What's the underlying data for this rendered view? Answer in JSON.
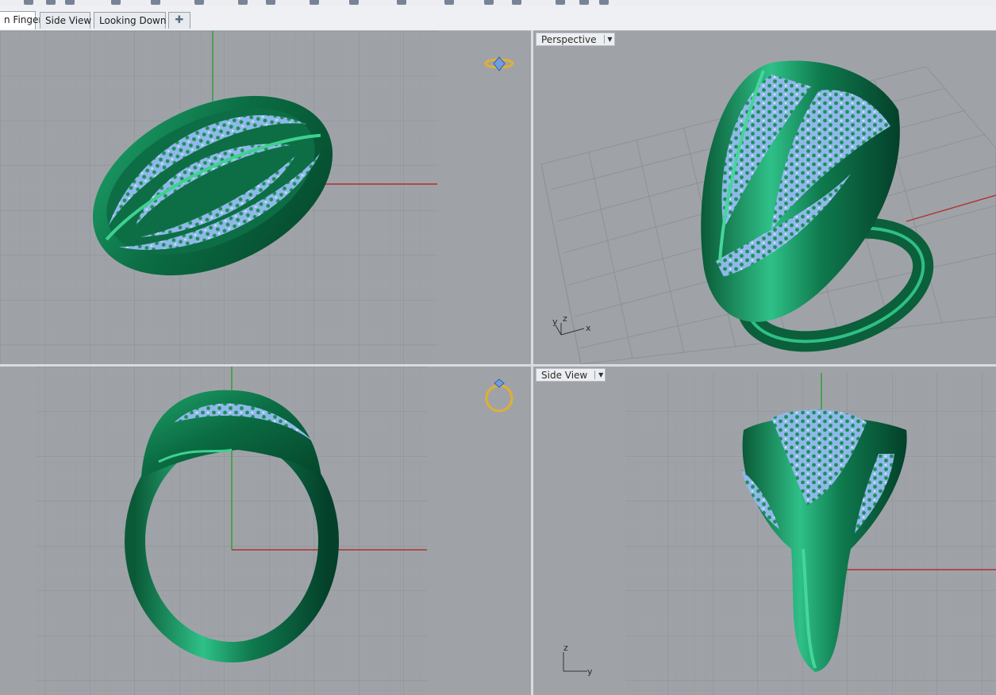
{
  "tabs": [
    {
      "label": "n Finger",
      "active": true
    },
    {
      "label": "Side View",
      "active": false
    },
    {
      "label": "Looking Down",
      "active": false
    }
  ],
  "add_tab_icon": "plus-icon",
  "viewports": {
    "top_left": {
      "label": ""
    },
    "top_right": {
      "label": "Perspective"
    },
    "bottom_left": {
      "label": ""
    },
    "bottom_right": {
      "label": "Side View"
    }
  },
  "axes": {
    "perspective": {
      "z": "z",
      "y": "y",
      "x": "x"
    },
    "side": {
      "z": "z",
      "y": "y"
    }
  },
  "colors": {
    "background": "#9fa3a8",
    "grid_minor": "#8f9398",
    "ring_green": "#0f7a4e",
    "ring_highlight": "#39c28a",
    "gem_blue": "#8fb8ea",
    "x_axis": "#b03030",
    "y_axis": "#2f9b2f",
    "gumball_gold": "#e0b030"
  }
}
